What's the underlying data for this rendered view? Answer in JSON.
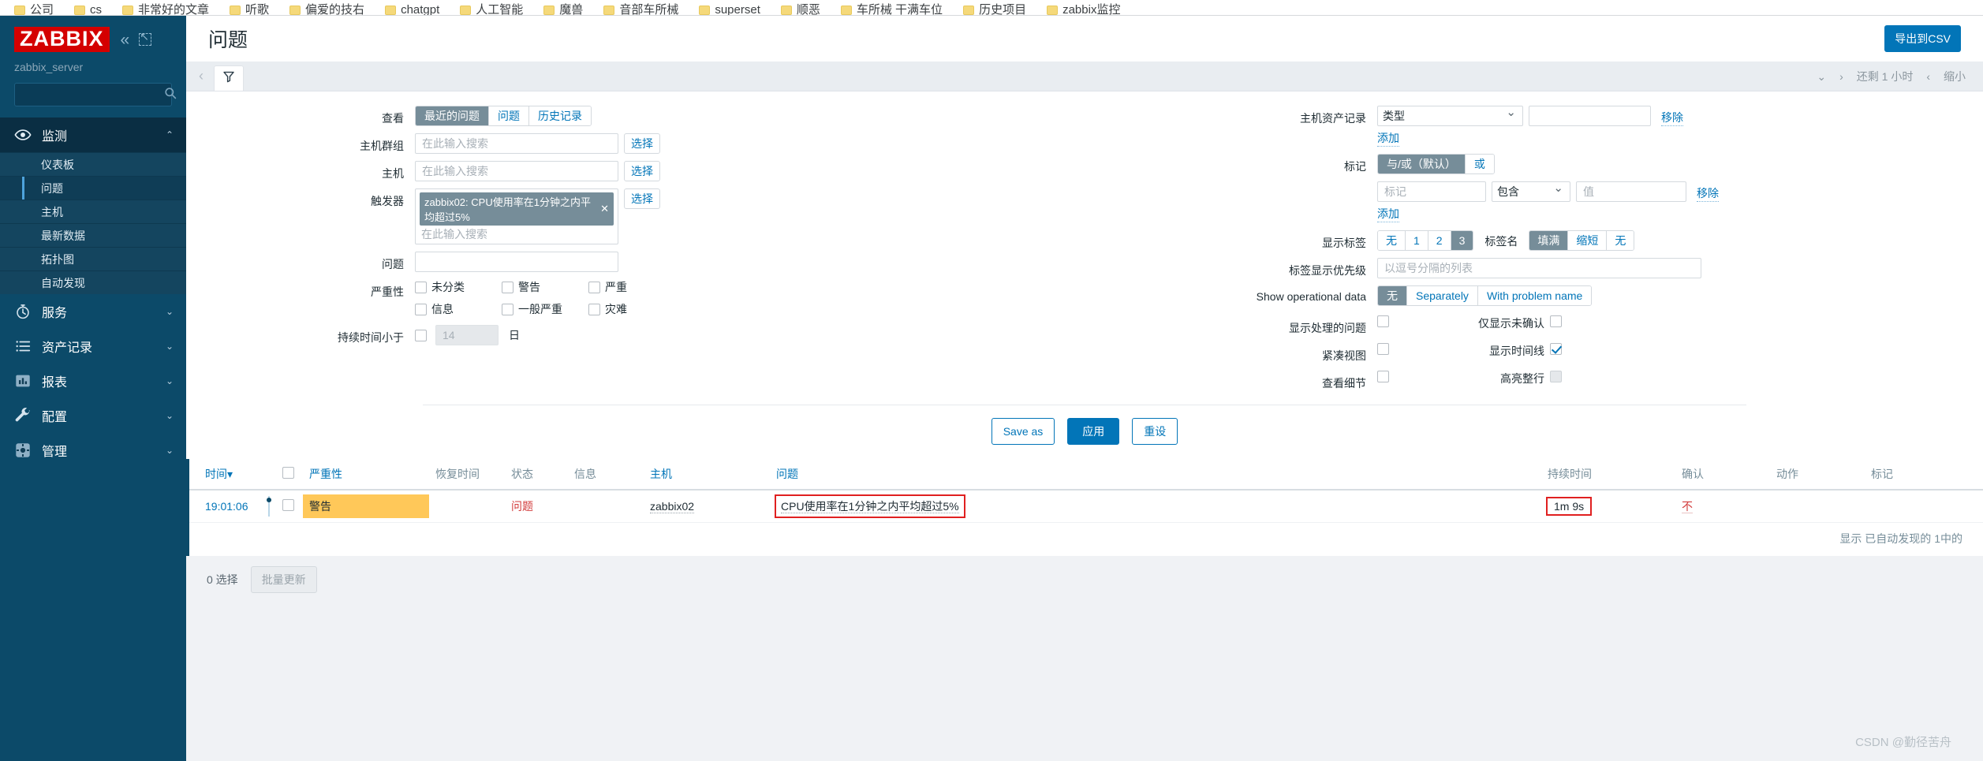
{
  "bookmarks": [
    {
      "label": "公司"
    },
    {
      "label": "cs"
    },
    {
      "label": "非常好的文章"
    },
    {
      "label": "听歌"
    },
    {
      "label": "偏爱的技右"
    },
    {
      "label": "chatgpt"
    },
    {
      "label": "人工智能"
    },
    {
      "label": "魔兽"
    },
    {
      "label": "音部车所械"
    },
    {
      "label": "superset"
    },
    {
      "label": "顺恶"
    },
    {
      "label": "车所械 干满车位"
    },
    {
      "label": "历史项目"
    },
    {
      "label": "zabbix监控"
    }
  ],
  "sidebar": {
    "logo": "ZABBIX",
    "collapse_icon": "«",
    "expand_icon": "expand-icon",
    "server_name": "zabbix_server",
    "search_placeholder": "",
    "groups": [
      {
        "label": "监测",
        "icon": "eye-icon",
        "expanded": true,
        "chevron": "⌃",
        "items": [
          {
            "label": "仪表板",
            "selected": false
          },
          {
            "label": "问题",
            "selected": true
          },
          {
            "label": "主机",
            "selected": false
          },
          {
            "label": "最新数据",
            "selected": false
          },
          {
            "label": "拓扑图",
            "selected": false
          },
          {
            "label": "自动发现",
            "selected": false
          }
        ]
      },
      {
        "label": "服务",
        "icon": "stopwatch-icon",
        "expanded": false,
        "chevron": "⌄",
        "items": []
      },
      {
        "label": "资产记录",
        "icon": "list-icon",
        "expanded": false,
        "chevron": "⌄",
        "items": []
      },
      {
        "label": "报表",
        "icon": "chart-icon",
        "expanded": false,
        "chevron": "⌄",
        "items": []
      },
      {
        "label": "配置",
        "icon": "wrench-icon",
        "expanded": false,
        "chevron": "⌄",
        "items": []
      },
      {
        "label": "管理",
        "icon": "gear-icon",
        "expanded": false,
        "chevron": "⌄",
        "items": []
      }
    ]
  },
  "header": {
    "title": "问题",
    "export_csv": "导出到CSV"
  },
  "tabbar": {
    "prev_arrow": "‹",
    "filter_icon": "filter-icon",
    "chevron_down": "⌄",
    "next_arrow": "›",
    "time_left": "还剩 1 小时",
    "zoom_prev": "‹",
    "zoom_out": "缩小"
  },
  "filter": {
    "view": {
      "label": "查看",
      "options": [
        "最近的问题",
        "问题",
        "历史记录"
      ],
      "selected": "最近的问题"
    },
    "host_group": {
      "label": "主机群组",
      "placeholder": "在此输入搜索",
      "value": "",
      "select_btn": "选择"
    },
    "host": {
      "label": "主机",
      "placeholder": "在此输入搜索",
      "value": "",
      "select_btn": "选择"
    },
    "trigger": {
      "label": "触发器",
      "chip": "zabbix02: CPU使用率在1分钟之内平均超过5%",
      "chip_remove": "✕",
      "placeholder": "在此输入搜索",
      "select_btn": "选择"
    },
    "problem": {
      "label": "问题",
      "value": "",
      "placeholder": ""
    },
    "severity": {
      "label": "严重性",
      "items": [
        {
          "label": "未分类",
          "checked": false
        },
        {
          "label": "警告",
          "checked": false
        },
        {
          "label": "严重",
          "checked": false
        },
        {
          "label": "信息",
          "checked": false
        },
        {
          "label": "一般严重",
          "checked": false
        },
        {
          "label": "灾难",
          "checked": false
        }
      ]
    },
    "age": {
      "label": "持续时间小于",
      "checked": false,
      "value": "",
      "placeholder": "14",
      "unit": "日"
    },
    "host_inventory": {
      "label": "主机资产记录",
      "field_selected": "类型",
      "field_options": [
        "类型"
      ],
      "value": "",
      "remove": "移除",
      "add": "添加"
    },
    "tags": {
      "label": "标记",
      "operator_options": [
        "与/或（默认）",
        "或"
      ],
      "operator_selected": "与/或（默认）",
      "tag_placeholder": "标记",
      "tag_value": "",
      "condition_selected": "包含",
      "condition_options": [
        "包含"
      ],
      "value_placeholder": "值",
      "value_value": "",
      "remove": "移除",
      "add": "添加"
    },
    "show_tags": {
      "label": "显示标签",
      "options": [
        "无",
        "1",
        "2",
        "3"
      ],
      "selected": "3"
    },
    "tag_name": {
      "label": "标签名",
      "options": [
        "填满",
        "缩短",
        "无"
      ],
      "selected": "填满"
    },
    "tag_priority": {
      "label": "标签显示优先级",
      "placeholder": "以逗号分隔的列表",
      "value": ""
    },
    "operational_data": {
      "label": "Show operational data",
      "options": [
        "无",
        "Separately",
        "With problem name"
      ],
      "selected": "无"
    },
    "toggles": [
      {
        "label": "显示处理的问题",
        "checked": false,
        "disabled": false
      },
      {
        "label": "仅显示未确认",
        "checked": false,
        "disabled": false
      },
      {
        "label": "紧凑视图",
        "checked": false,
        "disabled": false
      },
      {
        "label": "显示时间线",
        "checked": true,
        "disabled": false
      },
      {
        "label": "查看细节",
        "checked": false,
        "disabled": false
      },
      {
        "label": "高亮整行",
        "checked": false,
        "disabled": true
      }
    ],
    "actions": {
      "save_as": "Save as",
      "apply": "应用",
      "reset": "重设"
    }
  },
  "table": {
    "columns": [
      {
        "key": "time",
        "label": "时间",
        "sort": "▾"
      },
      {
        "key": "timeline",
        "label": ""
      },
      {
        "key": "checkbox",
        "label": ""
      },
      {
        "key": "severity",
        "label": "严重性"
      },
      {
        "key": "recovery_time",
        "label": "恢复时间"
      },
      {
        "key": "status",
        "label": "状态"
      },
      {
        "key": "info",
        "label": "信息"
      },
      {
        "key": "host",
        "label": "主机"
      },
      {
        "key": "problem",
        "label": "问题"
      },
      {
        "key": "duration",
        "label": "持续时间"
      },
      {
        "key": "ack",
        "label": "确认"
      },
      {
        "key": "actions",
        "label": "动作"
      },
      {
        "key": "tags",
        "label": "标记"
      }
    ],
    "rows": [
      {
        "time": "19:01:06",
        "severity": "警告",
        "recovery_time": "",
        "status": "问题",
        "info": "",
        "host": "zabbix02",
        "problem": "CPU使用率在1分钟之内平均超过5%",
        "duration": "1m 9s",
        "ack": "不",
        "actions": "",
        "tags": ""
      }
    ],
    "footer": "显示 已自动发现的 1中的"
  },
  "bottom": {
    "selected_count": "0 选择",
    "mass_update": "批量更新"
  },
  "watermark": "CSDN @勤径苦舟",
  "colors": {
    "brand_red": "#d40000",
    "sidebar": "#0c4a69",
    "accent_blue": "#0275b8",
    "severity_warning": "#ffc859",
    "status_problem": "#d23b3b",
    "highlight_box": "#e02020"
  }
}
